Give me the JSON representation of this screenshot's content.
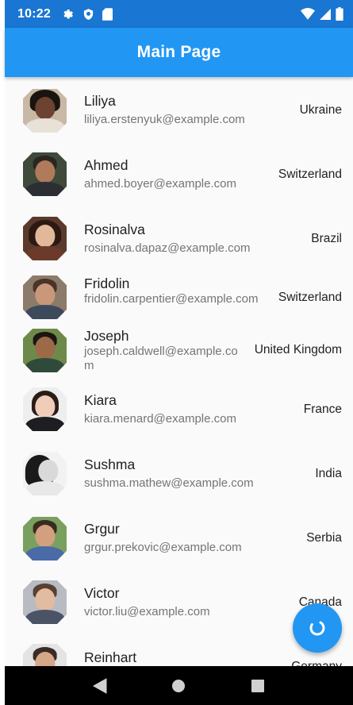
{
  "status_bar": {
    "time": "10:22",
    "icons": [
      "gear-icon",
      "shield-icon",
      "sd-card-icon",
      "wifi-icon",
      "signal-icon",
      "battery-icon"
    ]
  },
  "app_bar": {
    "title": "Main Page"
  },
  "contacts": [
    {
      "name": "Liliya",
      "email": "liliya.erstenyuk@example.com",
      "country": "Ukraine"
    },
    {
      "name": "Ahmed",
      "email": "ahmed.boyer@example.com",
      "country": "Switzerland"
    },
    {
      "name": "Rosinalva",
      "email": "rosinalva.dapaz@example.com",
      "country": "Brazil"
    },
    {
      "name": "Fridolin",
      "email": "fridolin.carpentier@example.com",
      "country": "Switzerland"
    },
    {
      "name": "Joseph",
      "email": "joseph.caldwell@example.com",
      "country": "United Kingdom"
    },
    {
      "name": "Kiara",
      "email": "kiara.menard@example.com",
      "country": "France"
    },
    {
      "name": "Sushma",
      "email": "sushma.mathew@example.com",
      "country": "India"
    },
    {
      "name": "Grgur",
      "email": "grgur.prekovic@example.com",
      "country": "Serbia"
    },
    {
      "name": "Victor",
      "email": "victor.liu@example.com",
      "country": "Canada"
    },
    {
      "name": "Reinhart",
      "email": "",
      "country": "Germany"
    }
  ],
  "fab": {
    "icon": "refresh-icon"
  },
  "nav_bar": {
    "icons": [
      "back-icon",
      "home-icon",
      "recents-icon"
    ]
  },
  "colors": {
    "status_bar": "#1976d2",
    "app_bar": "#2196f3",
    "fab": "#2196f3",
    "background": "#fafafa"
  }
}
